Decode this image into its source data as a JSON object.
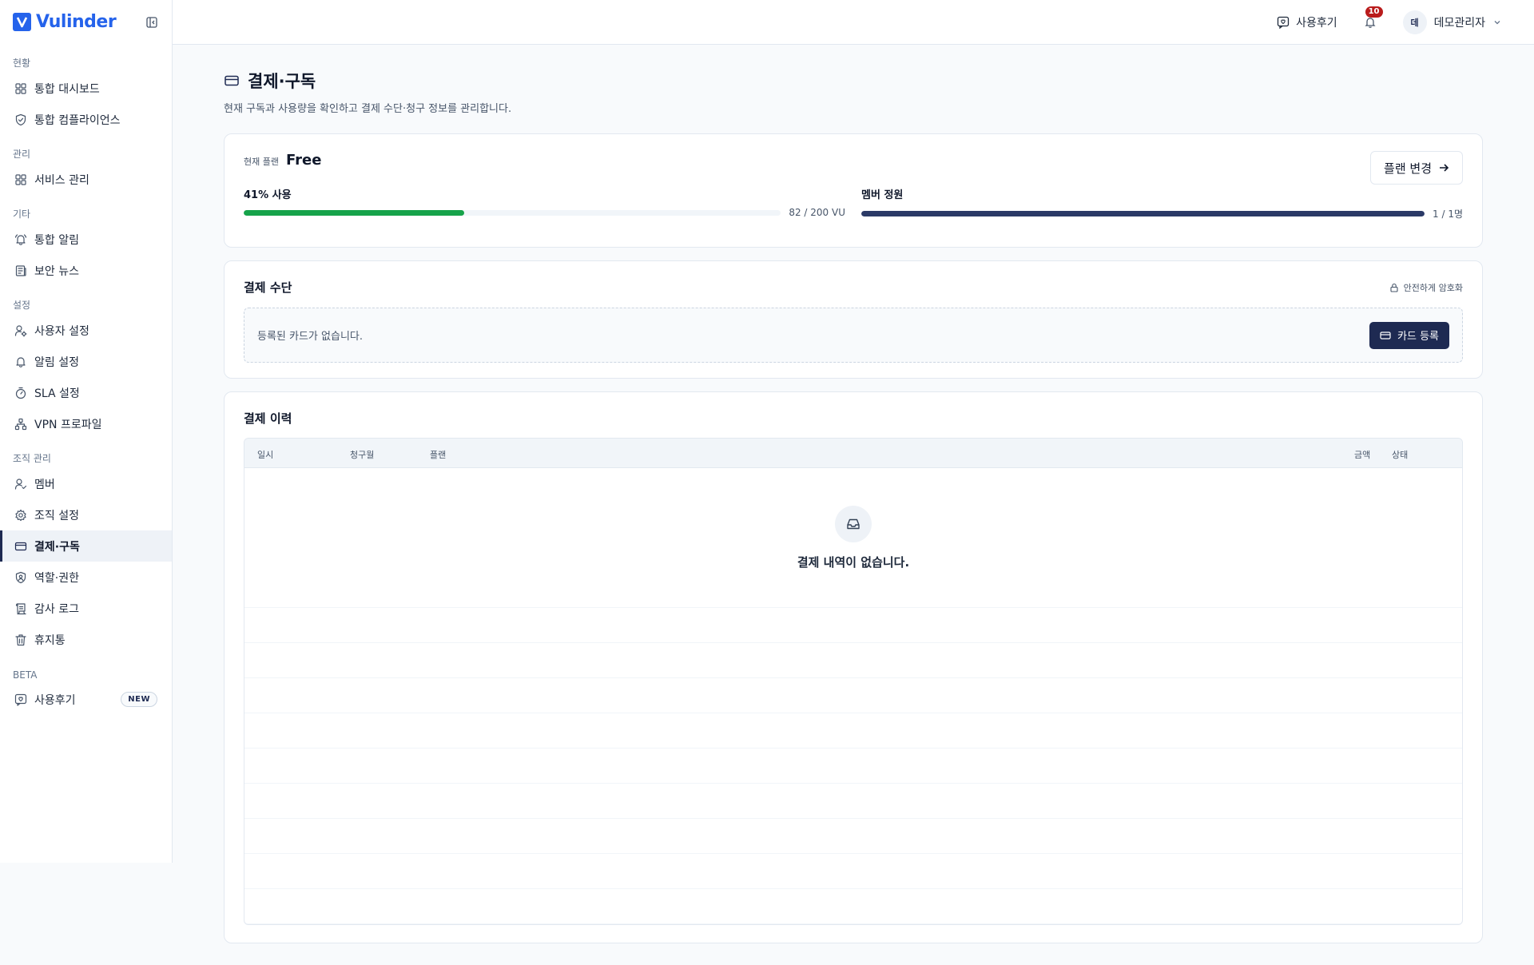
{
  "brand": {
    "name": "Vulinder"
  },
  "sidebar": {
    "sections": [
      {
        "title": "현황",
        "items": [
          {
            "label": "통합 대시보드",
            "icon": "grid-icon"
          },
          {
            "label": "통합 컴플라이언스",
            "icon": "shield-check-icon"
          }
        ]
      },
      {
        "title": "관리",
        "items": [
          {
            "label": "서비스 관리",
            "icon": "grid-icon"
          }
        ]
      },
      {
        "title": "기타",
        "items": [
          {
            "label": "통합 알림",
            "icon": "bell-ring-icon"
          },
          {
            "label": "보안 뉴스",
            "icon": "newspaper-icon"
          }
        ]
      },
      {
        "title": "설정",
        "items": [
          {
            "label": "사용자 설정",
            "icon": "user-cog-icon"
          },
          {
            "label": "알림 설정",
            "icon": "bell-icon"
          },
          {
            "label": "SLA 설정",
            "icon": "timer-icon"
          },
          {
            "label": "VPN 프로파일",
            "icon": "network-icon"
          }
        ]
      },
      {
        "title": "조직 관리",
        "items": [
          {
            "label": "멤버",
            "icon": "user-check-icon"
          },
          {
            "label": "조직 설정",
            "icon": "gear-icon"
          },
          {
            "label": "결제·구독",
            "icon": "credit-card-icon",
            "active": true
          },
          {
            "label": "역할·권한",
            "icon": "shield-user-icon"
          },
          {
            "label": "감사 로그",
            "icon": "scroll-icon"
          },
          {
            "label": "휴지통",
            "icon": "trash-icon"
          }
        ]
      },
      {
        "title": "BETA",
        "items": [
          {
            "label": "사용후기",
            "icon": "message-heart-icon",
            "badge": "NEW"
          }
        ]
      }
    ]
  },
  "header": {
    "review_label": "사용후기",
    "notification_count": "10",
    "user_initial": "데",
    "user_name": "데모관리자"
  },
  "page": {
    "title": "결제·구독",
    "subtitle": "현재 구독과 사용량을 확인하고 결제 수단·청구 정보를 관리합니다."
  },
  "plan": {
    "label": "현재 플랜",
    "name": "Free",
    "change_label": "플랜 변경",
    "usage": {
      "label": "41% 사용",
      "value_text": "82 / 200 VU",
      "percent": 41
    },
    "members": {
      "label": "멤버 정원",
      "value_text": "1 / 1명",
      "percent": 100
    }
  },
  "payment": {
    "title": "결제 수단",
    "secure_label": "안전하게 암호화",
    "empty_text": "등록된 카드가 없습니다.",
    "register_label": "카드 등록"
  },
  "history": {
    "title": "결제 이력",
    "columns": {
      "date": "일시",
      "billing_month": "청구월",
      "plan": "플랜",
      "amount": "금액",
      "status": "상태"
    },
    "empty_text": "결제 내역이 없습니다."
  },
  "colors": {
    "brand": "#2563eb",
    "accent": "#1e2a52",
    "usage": "#16a34a",
    "alert": "#b91c1c"
  }
}
